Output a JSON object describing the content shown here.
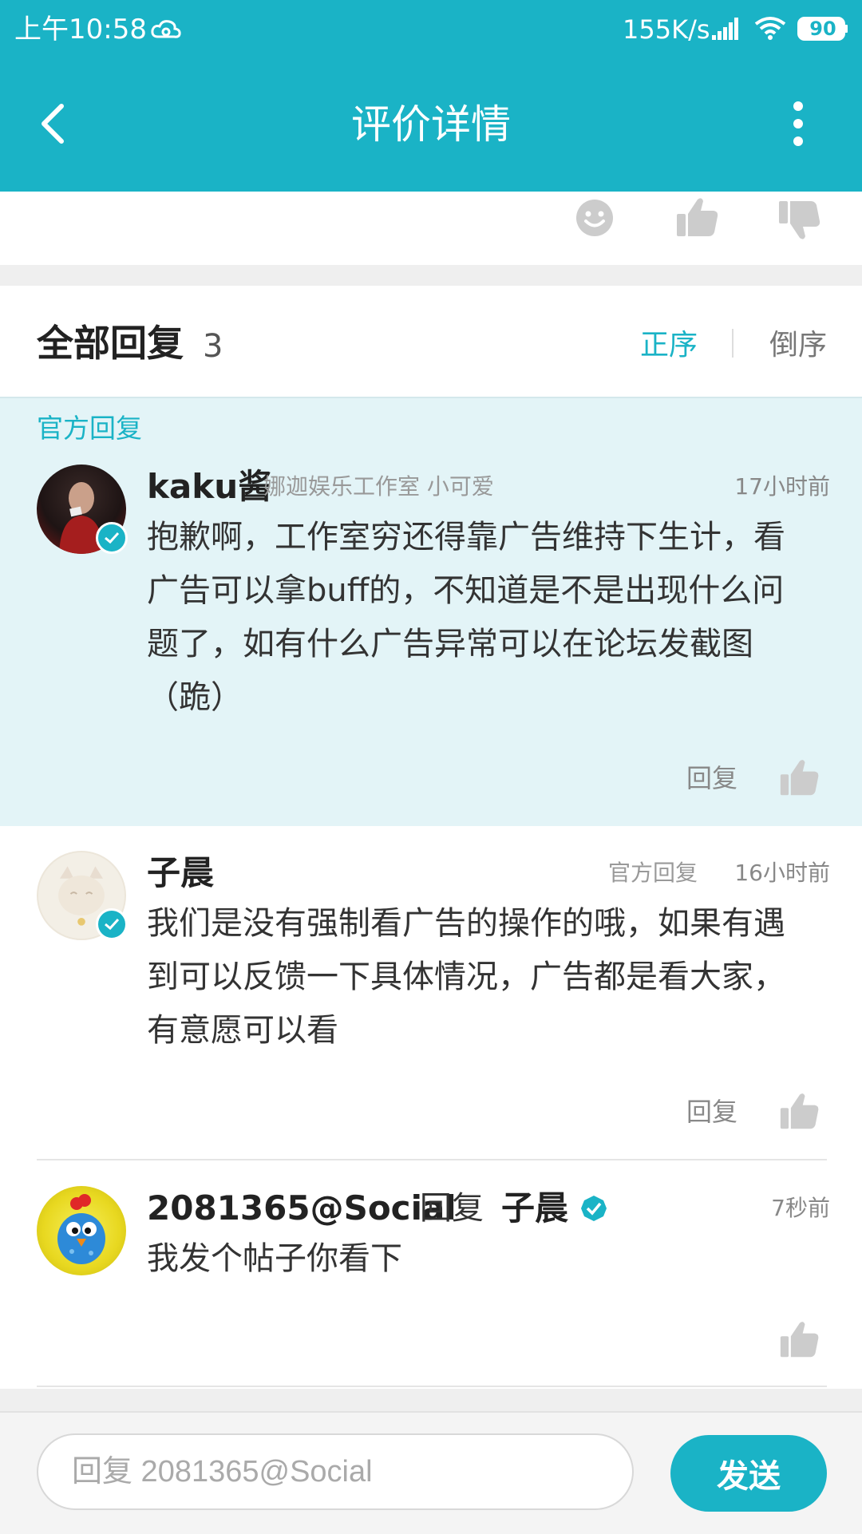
{
  "status_bar": {
    "time": "上午10:58",
    "speed": "155K/s",
    "battery": "90"
  },
  "header": {
    "title": "评价详情"
  },
  "replies": {
    "heading": "全部回复",
    "count": "3",
    "sort_asc": "正序",
    "sort_desc": "倒序"
  },
  "official_label": "官方回复",
  "comments": [
    {
      "username": "kaku酱",
      "meta": "娜迦娱乐工作室 小可爱",
      "time": "17小时前",
      "text_lines": [
        "抱歉啊，工作室穷还得靠广告维持下生计，看",
        "广告可以拿buff的，不知道是不是出现什么问",
        "题了，如有什么广告异常可以在论坛发截图",
        "（跪）"
      ],
      "reply_label": "回复"
    },
    {
      "username": "子晨",
      "meta": "官方回复",
      "time": "16小时前",
      "text_lines": [
        "我们是没有强制看广告的操作的哦，如果有遇",
        "到可以反馈一下具体情况，广告都是看大家，",
        "有意愿可以看"
      ],
      "reply_label": "回复"
    },
    {
      "username": "2081365@Social",
      "reply_word": "回复",
      "reply_to": "子晨",
      "time": "7秒前",
      "text": "我发个帖子你看下"
    }
  ],
  "input": {
    "placeholder": "回复 2081365@Social",
    "send_label": "发送"
  },
  "colors": {
    "accent": "#1ab3c6",
    "official_bg": "#e3f4f7"
  }
}
